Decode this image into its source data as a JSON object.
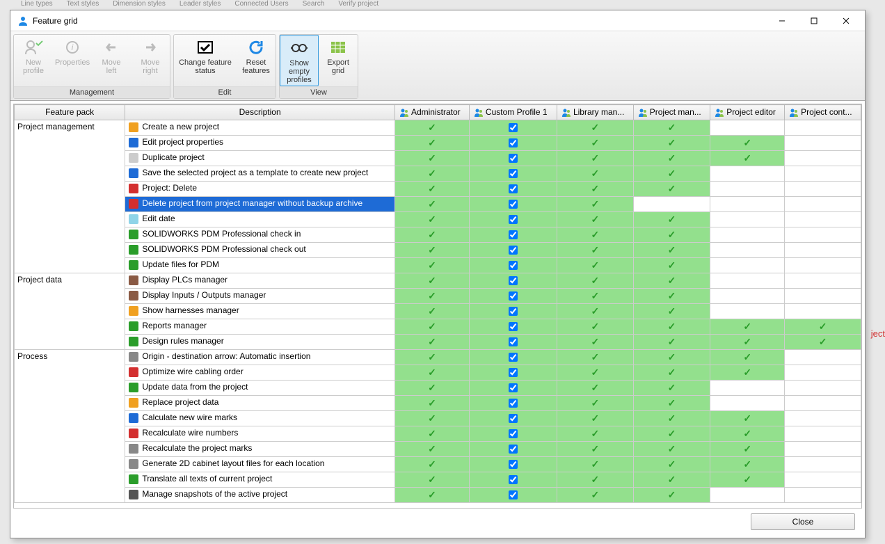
{
  "window": {
    "title": "Feature grid"
  },
  "bg_labels": [
    "Line types",
    "Text styles",
    "Dimension styles",
    "Leader styles",
    "Connected Users",
    "Search",
    "Verify project"
  ],
  "bg_right": "ject",
  "ribbon": {
    "groups": [
      {
        "label": "Management",
        "items": [
          {
            "name": "new-profile",
            "label": "New profile",
            "disabled": true
          },
          {
            "name": "properties",
            "label": "Properties",
            "disabled": true
          },
          {
            "name": "move-left",
            "label": "Move left",
            "disabled": true
          },
          {
            "name": "move-right",
            "label": "Move right",
            "disabled": true
          }
        ]
      },
      {
        "label": "Edit",
        "items": [
          {
            "name": "change-feature-status",
            "label": "Change feature status",
            "wide": true
          },
          {
            "name": "reset-features",
            "label": "Reset features"
          }
        ]
      },
      {
        "label": "View",
        "items": [
          {
            "name": "show-empty-profiles",
            "label": "Show empty profiles",
            "toggled": true
          },
          {
            "name": "export-grid",
            "label": "Export grid"
          }
        ]
      }
    ]
  },
  "columns": {
    "pack": "Feature pack",
    "desc": "Description",
    "profiles": [
      "Administrator",
      "Custom Profile 1",
      "Library man...",
      "Project man...",
      "Project editor",
      "Project cont..."
    ]
  },
  "rows": [
    {
      "group": "Project management",
      "desc": "Create a new project",
      "icon": "#f0a020",
      "perm": [
        1,
        1,
        1,
        1,
        0,
        0
      ]
    },
    {
      "desc": "Edit project properties",
      "icon": "#1e6bd6",
      "perm": [
        1,
        1,
        1,
        1,
        1,
        0
      ]
    },
    {
      "desc": "Duplicate project",
      "icon": "#cccccc",
      "perm": [
        1,
        1,
        1,
        1,
        1,
        0
      ]
    },
    {
      "desc": "Save the selected project as a template to create new project",
      "icon": "#1e6bd6",
      "perm": [
        1,
        1,
        1,
        1,
        0,
        0
      ]
    },
    {
      "desc": "Project: Delete",
      "icon": "#d32f2f",
      "perm": [
        1,
        1,
        1,
        1,
        0,
        0
      ]
    },
    {
      "desc": "Delete project from project manager without backup archive",
      "icon": "#d32f2f",
      "selected": true,
      "perm": [
        1,
        1,
        1,
        0,
        0,
        0
      ]
    },
    {
      "desc": "Edit date",
      "icon": "#8fd4e8",
      "perm": [
        1,
        1,
        1,
        1,
        0,
        0
      ]
    },
    {
      "desc": "SOLIDWORKS PDM Professional check in",
      "icon": "#2a9d2a",
      "perm": [
        1,
        1,
        1,
        1,
        0,
        0
      ]
    },
    {
      "desc": "SOLIDWORKS PDM Professional check out",
      "icon": "#2a9d2a",
      "perm": [
        1,
        1,
        1,
        1,
        0,
        0
      ]
    },
    {
      "desc": "Update files for PDM",
      "icon": "#2a9d2a",
      "perm": [
        1,
        1,
        1,
        1,
        0,
        0
      ]
    },
    {
      "group": "Project data",
      "desc": "Display PLCs manager",
      "icon": "#8a5a44",
      "perm": [
        1,
        1,
        1,
        1,
        0,
        0
      ]
    },
    {
      "desc": "Display Inputs / Outputs manager",
      "icon": "#8a5a44",
      "perm": [
        1,
        1,
        1,
        1,
        0,
        0
      ]
    },
    {
      "desc": "Show harnesses manager",
      "icon": "#f0a020",
      "perm": [
        1,
        1,
        1,
        1,
        0,
        0
      ]
    },
    {
      "desc": "Reports manager",
      "icon": "#2a9d2a",
      "perm": [
        1,
        1,
        1,
        1,
        1,
        1
      ]
    },
    {
      "desc": "Design rules manager",
      "icon": "#2a9d2a",
      "perm": [
        1,
        1,
        1,
        1,
        1,
        1
      ]
    },
    {
      "group": "Process",
      "desc": "Origin - destination arrow: Automatic insertion",
      "icon": "#888888",
      "perm": [
        1,
        1,
        1,
        1,
        1,
        0
      ]
    },
    {
      "desc": "Optimize wire cabling order",
      "icon": "#d32f2f",
      "perm": [
        1,
        1,
        1,
        1,
        1,
        0
      ]
    },
    {
      "desc": "Update data from the project",
      "icon": "#2a9d2a",
      "perm": [
        1,
        1,
        1,
        1,
        0,
        0
      ]
    },
    {
      "desc": "Replace project data",
      "icon": "#f0a020",
      "perm": [
        1,
        1,
        1,
        1,
        0,
        0
      ]
    },
    {
      "desc": "Calculate new wire marks",
      "icon": "#1e6bd6",
      "perm": [
        1,
        1,
        1,
        1,
        1,
        0
      ]
    },
    {
      "desc": "Recalculate wire numbers",
      "icon": "#d32f2f",
      "perm": [
        1,
        1,
        1,
        1,
        1,
        0
      ]
    },
    {
      "desc": "Recalculate the project marks",
      "icon": "#888888",
      "perm": [
        1,
        1,
        1,
        1,
        1,
        0
      ]
    },
    {
      "desc": "Generate 2D cabinet layout files for each location",
      "icon": "#888888",
      "perm": [
        1,
        1,
        1,
        1,
        1,
        0
      ]
    },
    {
      "desc": "Translate all texts of current project",
      "icon": "#2a9d2a",
      "perm": [
        1,
        1,
        1,
        1,
        1,
        0
      ]
    },
    {
      "desc": "Manage snapshots of the active project",
      "icon": "#555555",
      "perm": [
        1,
        1,
        1,
        1,
        0,
        0
      ]
    }
  ],
  "group_spans": {
    "Project management": 10,
    "Project data": 5,
    "Process": 10
  },
  "footer": {
    "close_label": "Close"
  }
}
